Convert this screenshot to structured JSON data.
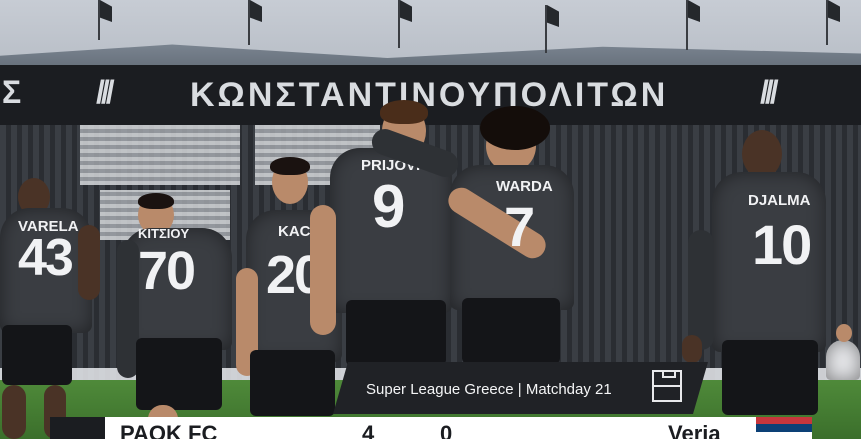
{
  "stadium": {
    "banner_text": "ΚΩΝΣΤΑΝΤΙΝΟΥΠΟΛΙΤΩΝ",
    "banner_left_mark": "Σ",
    "banner_mid_mark": "///",
    "banner_right_mark": "///"
  },
  "players": [
    {
      "name": "VARELA",
      "number": "43"
    },
    {
      "name": "KITΣIOY",
      "number": "70"
    },
    {
      "name": "KACE",
      "number": "20"
    },
    {
      "name": "PRIJOVIC",
      "number": "9"
    },
    {
      "name": "WARDA",
      "number": "7"
    },
    {
      "name": "DJALMA",
      "number": "10"
    }
  ],
  "info": {
    "competition": "Super League Greece | Matchday 21"
  },
  "scoreboard": {
    "home_team": "PAOK FC",
    "home_score": "4",
    "away_score": "0",
    "away_team": "Veria"
  },
  "colors": {
    "kit": "#3a3d42",
    "info_bar": "#202226",
    "serbia_red": "#c6363c",
    "serbia_blue": "#0c4076"
  }
}
